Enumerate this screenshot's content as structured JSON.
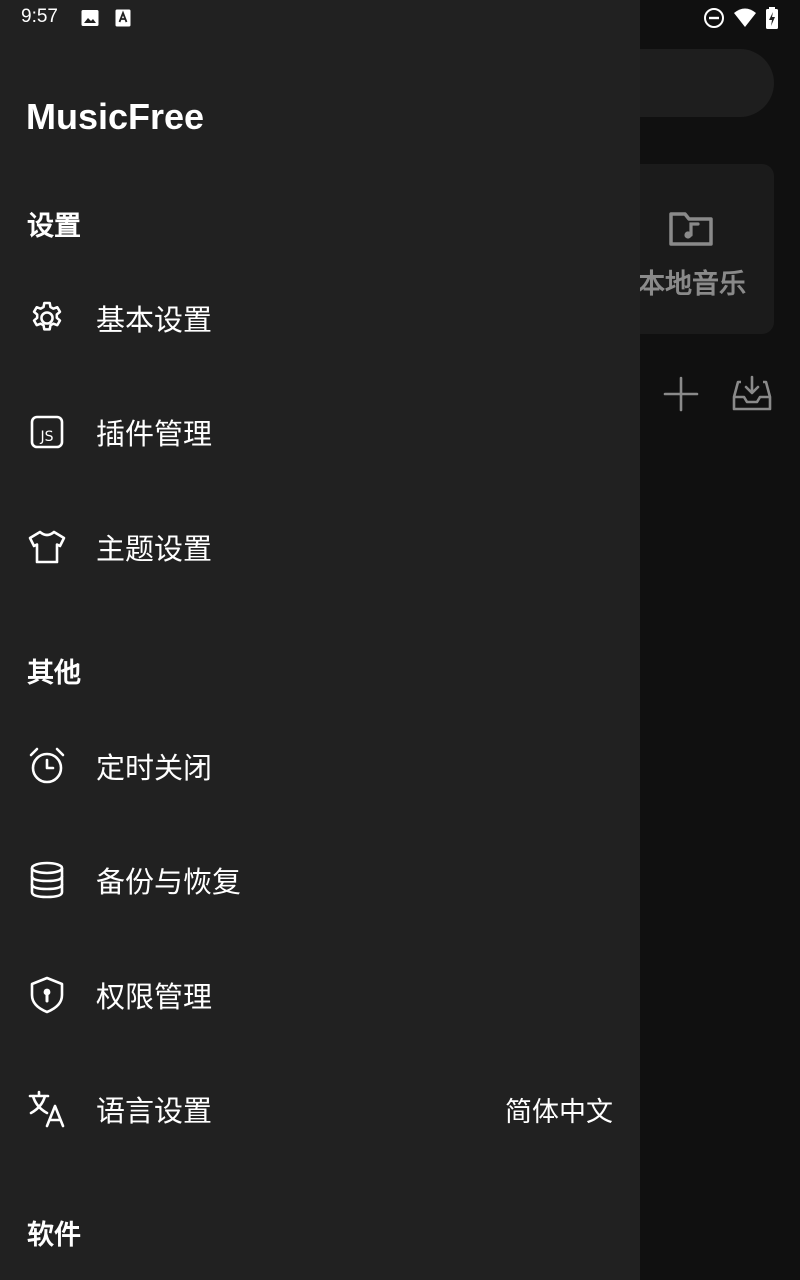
{
  "status_bar": {
    "time": "9:57",
    "left_icons": [
      "image-icon",
      "font-a-icon"
    ],
    "right_icons": [
      "do-not-disturb-icon",
      "wifi-icon",
      "battery-charging-icon"
    ]
  },
  "background": {
    "card_label": "本地音乐",
    "card_icon": "music-folder-icon",
    "actions": [
      "add-icon",
      "inbox-download-icon"
    ]
  },
  "drawer": {
    "app_title": "MusicFree",
    "sections": [
      {
        "header": "设置",
        "items": [
          {
            "label": "基本设置",
            "icon": "gear-icon"
          },
          {
            "label": "插件管理",
            "icon": "js-file-icon"
          },
          {
            "label": "主题设置",
            "icon": "tshirt-icon"
          }
        ]
      },
      {
        "header": "其他",
        "items": [
          {
            "label": "定时关闭",
            "icon": "alarm-clock-icon"
          },
          {
            "label": "备份与恢复",
            "icon": "database-icon"
          },
          {
            "label": "权限管理",
            "icon": "shield-keyhole-icon"
          },
          {
            "label": "语言设置",
            "icon": "translate-icon",
            "value": "简体中文"
          }
        ]
      },
      {
        "header": "软件",
        "items": []
      }
    ]
  },
  "colors": {
    "drawer_bg": "#212121",
    "app_bg": "#101010",
    "text": "#ffffff",
    "muted_text": "#8a8a8a"
  }
}
